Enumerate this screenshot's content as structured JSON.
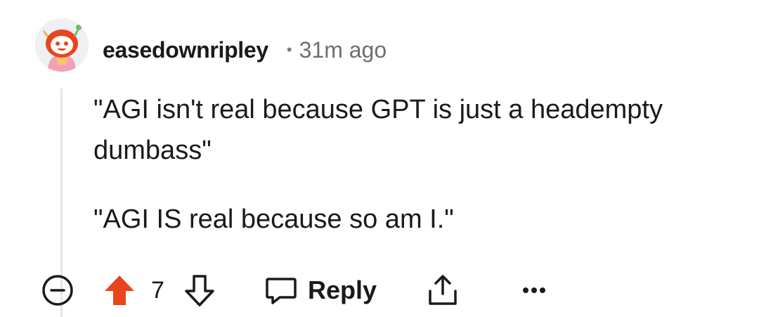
{
  "comment": {
    "username": "easedownripley",
    "separator": "•",
    "time": "31m ago",
    "paragraphs": [
      "\"AGI isn't real because GPT is just a headempty dumbass\"",
      "\"AGI IS real because so am I.\""
    ]
  },
  "actions": {
    "score": "7",
    "reply_label": "Reply",
    "collapse_icon": "minus-circle-icon",
    "upvote_icon": "arrow-up-filled-icon",
    "downvote_icon": "arrow-down-outline-icon",
    "reply_icon": "speech-bubble-icon",
    "share_icon": "share-upload-icon",
    "more_icon": "more-horizontal-icon"
  },
  "colors": {
    "upvote": "#e8451e",
    "text": "#1a1a1b",
    "muted": "#6c6f73",
    "thread_line": "#e4e6e8"
  }
}
